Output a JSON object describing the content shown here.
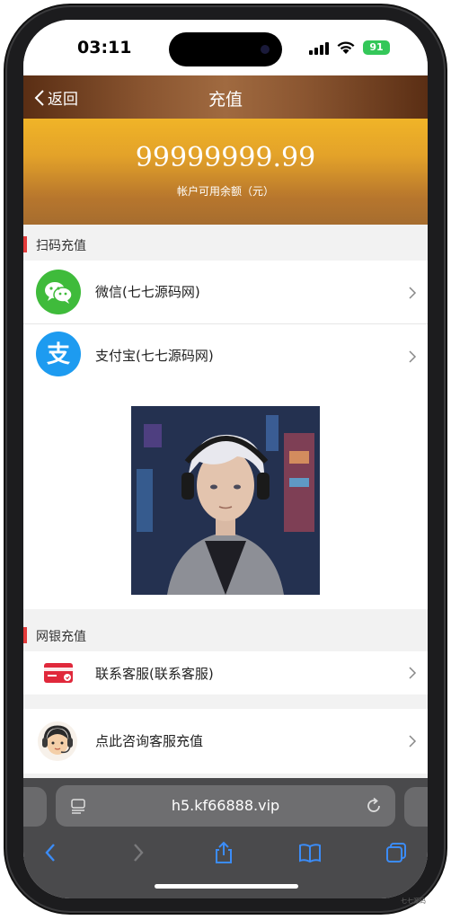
{
  "status_bar": {
    "time": "03:11",
    "battery": "91"
  },
  "header": {
    "back_label": "返回",
    "title": "充值"
  },
  "balance": {
    "amount": "99999999.99",
    "label": "帐户可用余额（元）"
  },
  "scan_section": {
    "title": "扫码充值",
    "items": [
      {
        "label": "微信(七七源码网)",
        "icon": "wechat-icon",
        "color": "#3fbb3b"
      },
      {
        "label": "支付宝(七七源码网)",
        "icon": "alipay-icon",
        "color": "#1d9bf0"
      }
    ]
  },
  "bank_section": {
    "title": "网银充值",
    "items": [
      {
        "label": "联系客服(联系客服)",
        "icon": "bank-card-icon",
        "color": "#e0283b"
      }
    ]
  },
  "service_item": {
    "label": "点此咨询客服充值",
    "icon": "customer-service-icon"
  },
  "browser": {
    "url": "h5.kf66888.vip"
  },
  "watermark": "七七源码",
  "colors": {
    "accent_red": "#e23b3b",
    "header_brown": "#8a5530",
    "balance_gold": "#e3a229"
  }
}
